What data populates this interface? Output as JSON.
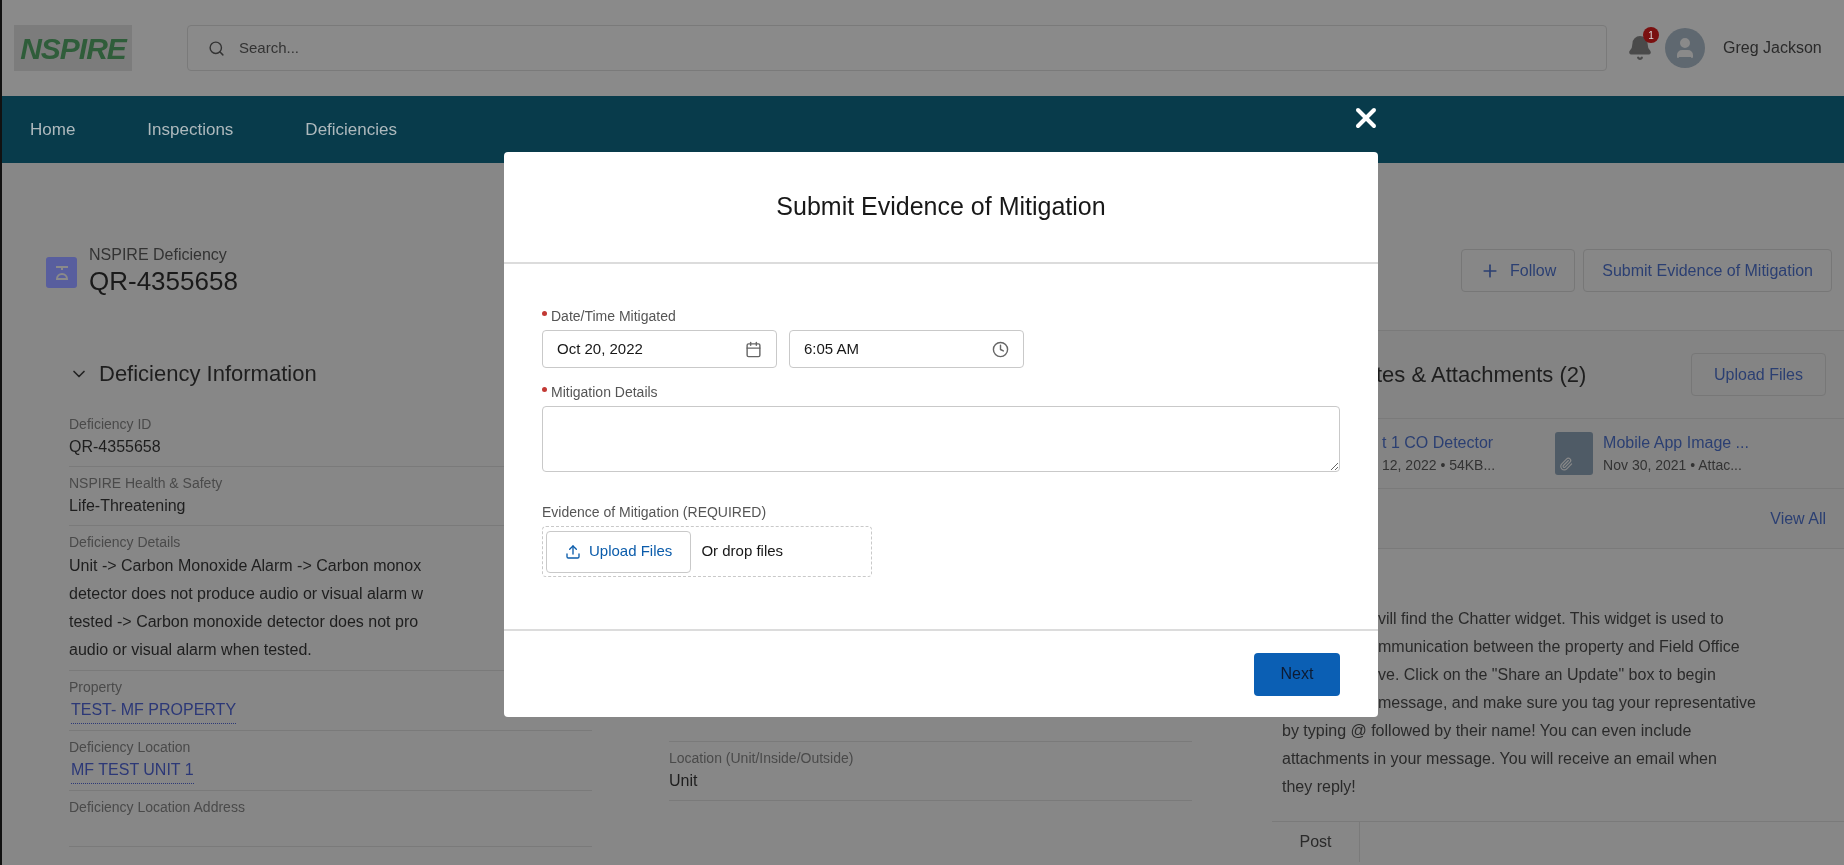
{
  "header": {
    "logo": "NSPIRE",
    "search": {
      "placeholder": "Search..."
    },
    "notifications": {
      "count": "1"
    },
    "user": "Greg Jackson"
  },
  "nav": [
    "Home",
    "Inspections",
    "Deficiencies"
  ],
  "record": {
    "type": "NSPIRE Deficiency",
    "name": "QR-4355658",
    "actions": [
      {
        "label": "Follow",
        "kind": "follow"
      },
      {
        "label": "Submit Evidence of Mitigation",
        "kind": "plain"
      }
    ]
  },
  "section": {
    "title": "Deficiency Information",
    "expanded": true
  },
  "fields_left": [
    {
      "kind": "text",
      "label": "Deficiency ID",
      "value": "QR-4355658"
    },
    {
      "kind": "text",
      "label": "NSPIRE Health & Safety",
      "value": "Life-Threatening"
    },
    {
      "kind": "multiline",
      "label": "Deficiency Details",
      "lines": [
        "Unit -> Carbon Monoxide Alarm -> Carbon monox",
        "detector does not produce audio or visual alarm w",
        "tested -> Carbon monoxide detector does not pro",
        "audio or visual alarm when tested."
      ]
    },
    {
      "kind": "link",
      "label": "Property",
      "value": "TEST- MF PROPERTY"
    },
    {
      "kind": "link",
      "label": "Deficiency Location",
      "value": "MF TEST UNIT 1"
    },
    {
      "kind": "empty",
      "label": "Deficiency Location Address"
    }
  ],
  "fields_middle": [
    {
      "kind": "text",
      "label": "Location (Unit/Inside/Outside)",
      "value": "Unit"
    }
  ],
  "notes": {
    "title": "tes & Attachments (2)",
    "upload_button": "Upload Files",
    "files": [
      {
        "kind": "cut",
        "name": "t 1 CO Detector",
        "meta": "12, 2022 • 54KB..."
      },
      {
        "kind": "file",
        "name": "Mobile App Image ...",
        "meta": "Nov 30, 2021 • Attac..."
      }
    ],
    "view_all": "View All"
  },
  "chatter": {
    "lines": [
      {
        "kind": "cut",
        "text": "vill find the Chatter widget. This widget is used to"
      },
      {
        "kind": "cut",
        "text": "mmunication between the property and Field Office"
      },
      {
        "kind": "cut",
        "text": "ve. Click on the \"Share an Update\" box to begin"
      },
      {
        "kind": "cut",
        "text": "message, and make sure you tag your representative"
      },
      {
        "kind": "full",
        "text": "by typing @ followed by their name! You can even include"
      },
      {
        "kind": "full",
        "text": "attachments in your message. You will receive an email when"
      },
      {
        "kind": "full",
        "text": "they reply!"
      }
    ],
    "tab": "Post"
  },
  "modal": {
    "title": "Submit Evidence of Mitigation",
    "fields": [
      {
        "kind": "datetime",
        "label": "Date/Time Mitigated",
        "required": true,
        "date": "Oct 20, 2022",
        "time": "6:05 AM"
      },
      {
        "kind": "textarea",
        "label": "Mitigation Details",
        "required": true
      },
      {
        "kind": "upload",
        "label": "Evidence of Mitigation (REQUIRED)",
        "required": false,
        "button": "Upload Files",
        "hint": "Or drop files"
      }
    ],
    "next": "Next"
  }
}
